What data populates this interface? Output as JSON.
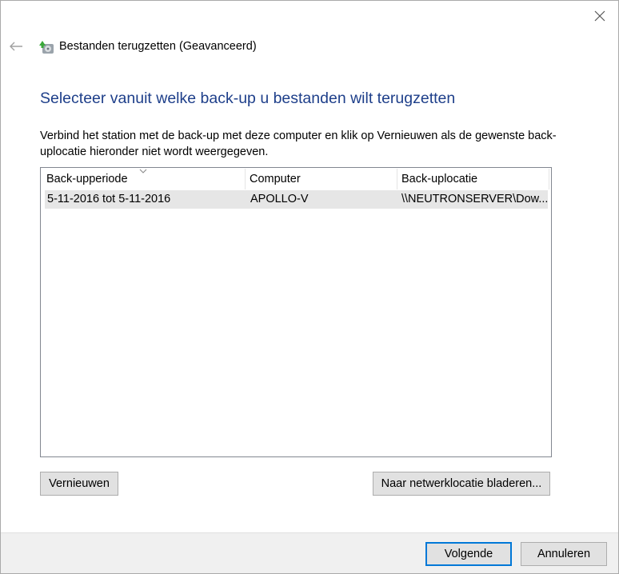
{
  "window": {
    "title": "Bestanden terugzetten (Geavanceerd)"
  },
  "icons": {
    "back": "back-arrow-icon",
    "close": "close-icon",
    "title": "restore-files-icon",
    "sort": "chevron-down-icon"
  },
  "page": {
    "heading": "Selecteer vanuit welke back-up u bestanden wilt terugzetten",
    "instructions": "Verbind het station met de back-up met deze computer en klik op Vernieuwen als de gewenste back-uplocatie hieronder niet wordt weergegeven."
  },
  "table": {
    "columns": [
      "Back-upperiode",
      "Computer",
      "Back-uplocatie"
    ],
    "rows": [
      {
        "period": "5-11-2016 tot 5-11-2016",
        "computer": "APOLLO-V",
        "location": "\\\\NEUTRONSERVER\\Dow..."
      }
    ]
  },
  "buttons": {
    "refresh": "Vernieuwen",
    "browse_network": "Naar netwerklocatie bladeren...",
    "next": "Volgende",
    "cancel": "Annuleren"
  },
  "colors": {
    "heading": "#1e3f8a",
    "selected_row": "#e6e6e6",
    "default_button_border": "#0078d7",
    "footer": "#f0f0f0"
  }
}
